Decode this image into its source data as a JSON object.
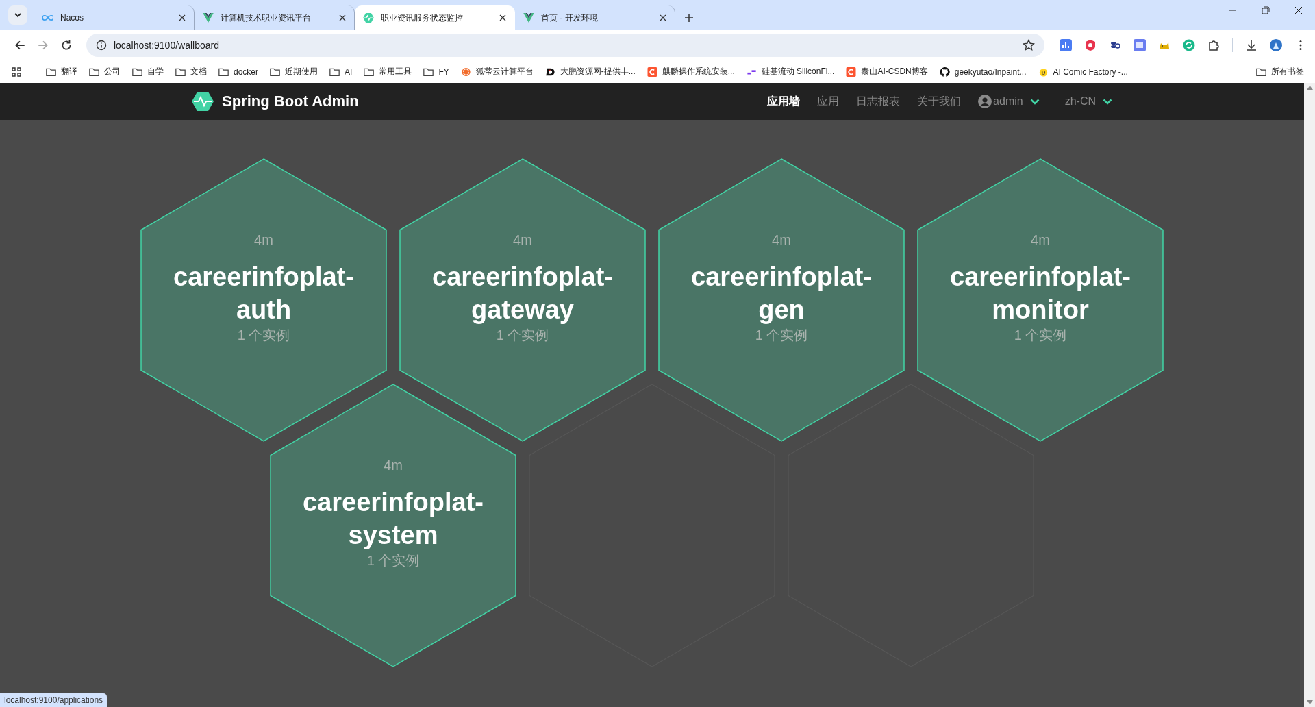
{
  "browser": {
    "tabs": [
      {
        "title": "Nacos",
        "kind": "nacos",
        "selected": false
      },
      {
        "title": "计算机技术职业资讯平台",
        "kind": "vue",
        "selected": false
      },
      {
        "title": "职业资讯服务状态监控",
        "kind": "sba",
        "selected": true
      },
      {
        "title": "首页 - 开发环境",
        "kind": "vue",
        "selected": false
      }
    ],
    "address": "localhost:9100/wallboard",
    "bookmarks": [
      {
        "label": "翻译",
        "kind": "folder"
      },
      {
        "label": "公司",
        "kind": "folder"
      },
      {
        "label": "自学",
        "kind": "folder"
      },
      {
        "label": "文档",
        "kind": "folder"
      },
      {
        "label": "docker",
        "kind": "folder"
      },
      {
        "label": "近期使用",
        "kind": "folder"
      },
      {
        "label": "AI",
        "kind": "folder"
      },
      {
        "label": "常用工具",
        "kind": "folder"
      },
      {
        "label": "FY",
        "kind": "folder"
      },
      {
        "label": "狐蒂云计算平台",
        "kind": "swirl"
      },
      {
        "label": "大鹏资源网-提供丰...",
        "kind": "d-logo"
      },
      {
        "label": "麒麟操作系统安装...",
        "kind": "c-logo"
      },
      {
        "label": "硅基流动 SiliconFl...",
        "kind": "bars"
      },
      {
        "label": "泰山AI-CSDN博客",
        "kind": "c-logo"
      },
      {
        "label": "geekyutao/Inpaint...",
        "kind": "github"
      },
      {
        "label": "AI Comic Factory -...",
        "kind": "emoji"
      }
    ],
    "all_bookmarks": "所有书签"
  },
  "app": {
    "title": "Spring Boot Admin",
    "nav": [
      {
        "label": "应用墙",
        "selected": true
      },
      {
        "label": "应用",
        "selected": false
      },
      {
        "label": "日志报表",
        "selected": false
      },
      {
        "label": "关于我们",
        "selected": false
      }
    ],
    "user": "admin",
    "language": "zh-CN"
  },
  "tiles": [
    {
      "kind": "app",
      "uptime": "4m",
      "name": "careerinfoplat-auth",
      "instances": "1 个实例"
    },
    {
      "kind": "app",
      "uptime": "4m",
      "name": "careerinfoplat-gateway",
      "instances": "1 个实例"
    },
    {
      "kind": "app",
      "uptime": "4m",
      "name": "careerinfoplat-gen",
      "instances": "1 个实例"
    },
    {
      "kind": "app",
      "uptime": "4m",
      "name": "careerinfoplat-monitor",
      "instances": "1 个实例"
    },
    {
      "kind": "app",
      "uptime": "4m",
      "name": "careerinfoplat-system",
      "instances": "1 个实例"
    },
    {
      "kind": "empty"
    },
    {
      "kind": "empty"
    }
  ],
  "status_url": "localhost:9100/applications"
}
